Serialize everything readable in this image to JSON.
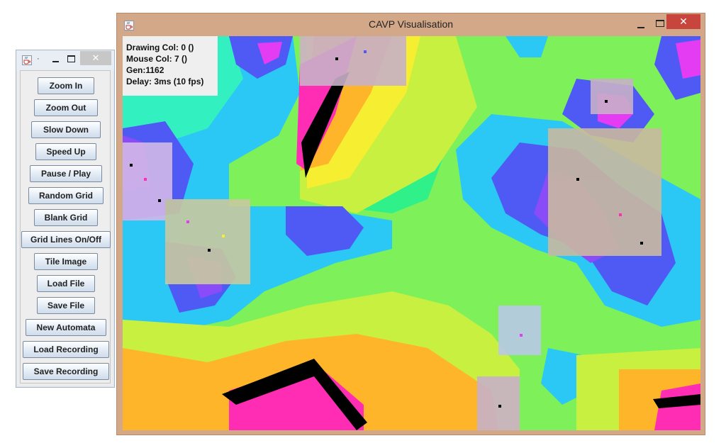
{
  "control_window": {
    "title": "·",
    "close_glyph": "✕",
    "buttons": [
      {
        "label": "Zoom In"
      },
      {
        "label": "Zoom Out"
      },
      {
        "label": "Slow Down"
      },
      {
        "label": "Speed Up"
      },
      {
        "label": "Pause / Play"
      },
      {
        "label": "Random Grid"
      },
      {
        "label": "Blank Grid"
      },
      {
        "label": "Grid Lines On/Off"
      },
      {
        "label": "Tile Image"
      },
      {
        "label": "Load File"
      },
      {
        "label": "Save File"
      },
      {
        "label": "New Automata"
      },
      {
        "label": "Load Recording"
      },
      {
        "label": "Save Recording"
      }
    ]
  },
  "main_window": {
    "title": "CAVP Visualisation",
    "close_glyph": "✕",
    "icon": "java-cup-icon",
    "overlay": {
      "drawing_col": "Drawing Col: 0 ()",
      "mouse_col": "Mouse Col: 7 ()",
      "gen": "Gen:1162",
      "delay": "Delay: 3ms (10 fps)"
    }
  },
  "colors": {
    "title_bar_active": "#d3a889",
    "close_active": "#c7453c",
    "close_inactive": "#c7c7c7",
    "cell_palette": [
      "#000000",
      "#ff2db4",
      "#e43cf2",
      "#8a4cf8",
      "#4f5af5",
      "#2bc8f5",
      "#33f0c0",
      "#30f08a",
      "#7df05a",
      "#c8f040",
      "#f6ee30",
      "#ffb52a",
      "#ff7a20"
    ]
  }
}
